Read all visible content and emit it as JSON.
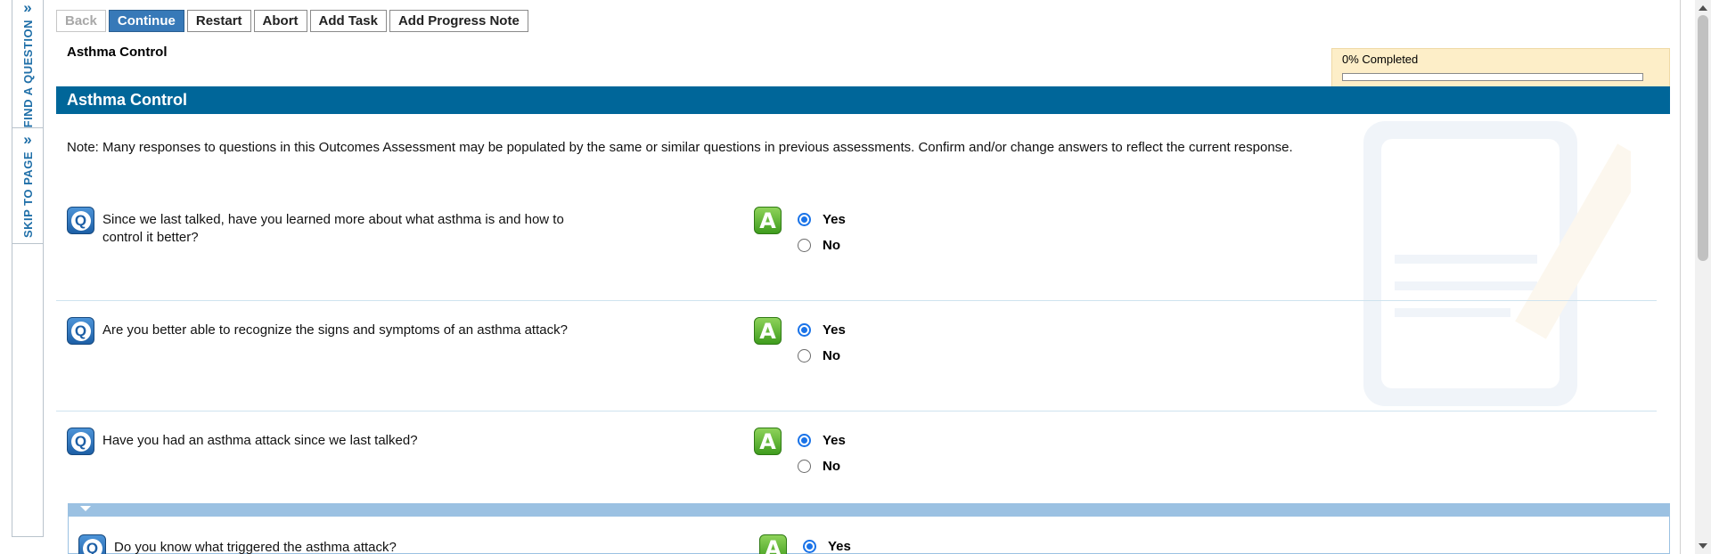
{
  "side_tabs": {
    "find_question": "FIND A QUESTION",
    "skip_to_page": "SKIP TO PAGE"
  },
  "toolbar": {
    "back": "Back",
    "continue": "Continue",
    "restart": "Restart",
    "abort": "Abort",
    "add_task": "Add Task",
    "add_progress_note": "Add Progress Note"
  },
  "page_subtitle": "Asthma Control",
  "progress": {
    "label": "0% Completed",
    "percent": 0
  },
  "section": {
    "title": "Asthma Control",
    "note": "Note: Many responses to questions in this Outcomes Assessment may be populated by the same or similar questions in previous assessments. Confirm and/or change answers to reflect the current response."
  },
  "questions": [
    {
      "text": "Since we last talked, have you learned more about what asthma is and how to control it better?",
      "options": [
        "Yes",
        "No"
      ],
      "selected": "Yes"
    },
    {
      "text": "Are you better able to recognize the signs and symptoms of an asthma attack?",
      "options": [
        "Yes",
        "No"
      ],
      "selected": "Yes"
    },
    {
      "text": "Have you had an asthma attack since we last talked?",
      "options": [
        "Yes",
        "No"
      ],
      "selected": "Yes"
    }
  ],
  "sub_question": {
    "text": "Do you know what triggered the asthma attack?",
    "options": [
      "Yes"
    ],
    "selected": "Yes"
  },
  "icons": {
    "question": "Q",
    "answer": "A"
  },
  "colors": {
    "section_header": "#006699",
    "primary_button": "#3779b8",
    "progress_bg": "#fdeec8"
  }
}
